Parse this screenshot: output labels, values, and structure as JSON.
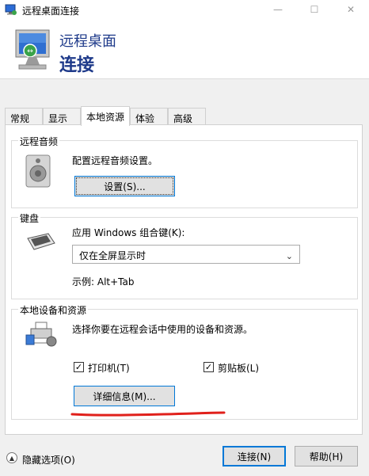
{
  "window": {
    "title": "远程桌面连接",
    "min_label": "—",
    "max_label": "☐",
    "close_label": "✕"
  },
  "banner": {
    "line1": "远程桌面",
    "line2": "连接"
  },
  "tabs": [
    {
      "label": "常规"
    },
    {
      "label": "显示"
    },
    {
      "label": "本地资源"
    },
    {
      "label": "体验"
    },
    {
      "label": "高级"
    }
  ],
  "remote_audio": {
    "title": "远程音频",
    "description": "配置远程音频设置。",
    "button_label": "设置(S)..."
  },
  "keyboard": {
    "title": "键盘",
    "label": "应用 Windows 组合键(K):",
    "selected": "仅在全屏显示时",
    "example": "示例: Alt+Tab"
  },
  "local_devices": {
    "title": "本地设备和资源",
    "description": "选择你要在远程会话中使用的设备和资源。",
    "printer": {
      "label": "打印机(T)",
      "checked": true
    },
    "clipboard": {
      "label": "剪贴板(L)",
      "checked": true
    },
    "details_button": "详细信息(M)..."
  },
  "footer": {
    "hide_options": "隐藏选项(O)",
    "connect": "连接(N)",
    "help": "帮助(H)"
  },
  "colors": {
    "title_blue": "#1e3a8a",
    "accent": "#0078d7",
    "annotation_red": "#e0201b"
  }
}
